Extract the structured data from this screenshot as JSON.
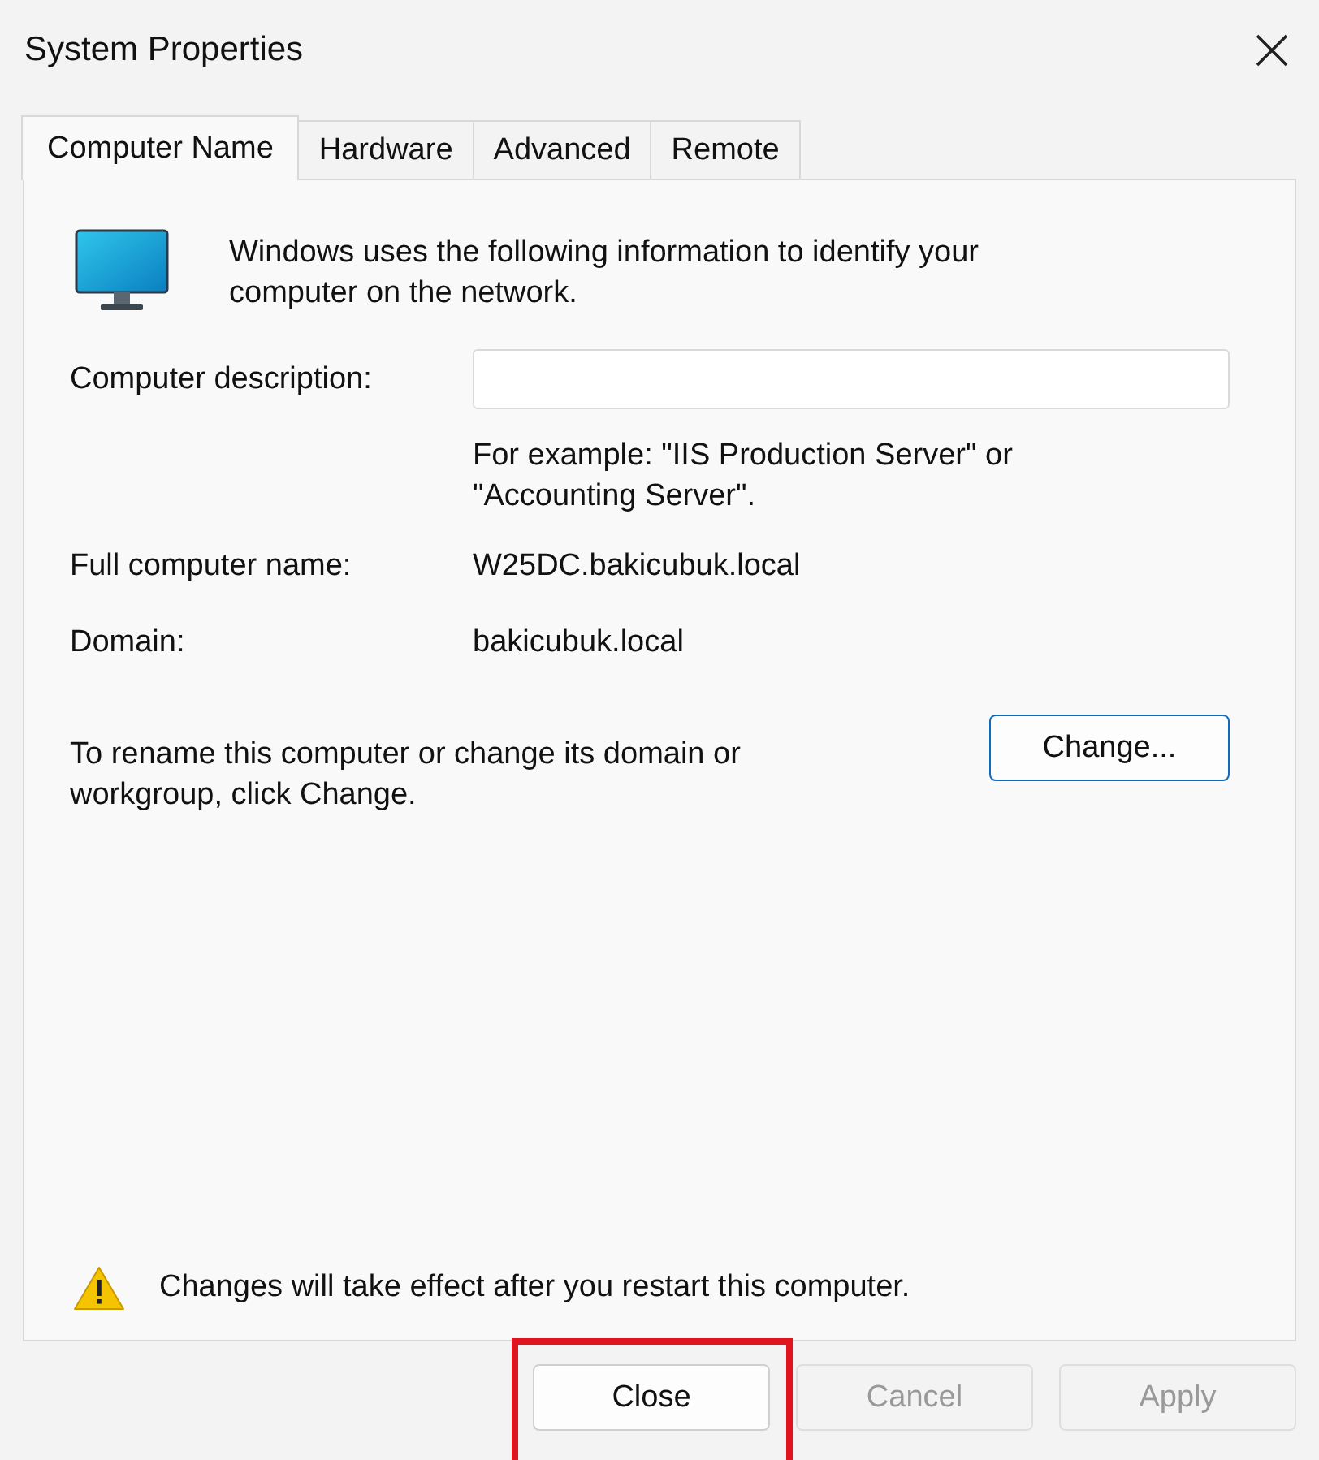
{
  "window": {
    "title": "System Properties"
  },
  "tabs": [
    {
      "label": "Computer Name",
      "selected": true
    },
    {
      "label": "Hardware",
      "selected": false
    },
    {
      "label": "Advanced",
      "selected": false
    },
    {
      "label": "Remote",
      "selected": false
    }
  ],
  "intro": "Windows uses the following information to identify your computer on the network.",
  "description": {
    "label": "Computer description:"
  },
  "example": "For example: \"IIS Production Server\" or \"Accounting Server\".",
  "fields": [
    {
      "label": "Full computer name:",
      "value": "W25DC.bakicubuk.local"
    },
    {
      "label": "Domain:",
      "value": "bakicubuk.local"
    }
  ],
  "rename": {
    "text": "To rename this computer or change its domain or workgroup, click Change.",
    "button": "Change..."
  },
  "warning": "Changes will take effect after you restart this computer.",
  "buttons": [
    {
      "label": "Close",
      "disabled": false,
      "highlighted": true
    },
    {
      "label": "Cancel",
      "disabled": true,
      "highlighted": false
    },
    {
      "label": "Apply",
      "disabled": true,
      "highlighted": false
    }
  ]
}
